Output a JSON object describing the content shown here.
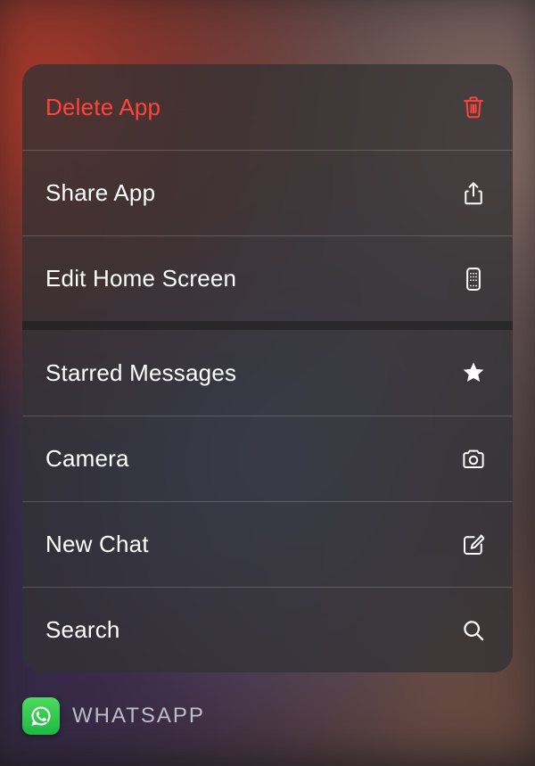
{
  "menu": {
    "groups": [
      {
        "items": [
          {
            "id": "delete-app",
            "label": "Delete App",
            "icon": "trash-icon",
            "destructive": true
          },
          {
            "id": "share-app",
            "label": "Share App",
            "icon": "share-icon",
            "destructive": false
          },
          {
            "id": "edit-home-screen",
            "label": "Edit Home Screen",
            "icon": "apps-grid-icon",
            "destructive": false
          }
        ]
      },
      {
        "items": [
          {
            "id": "starred-messages",
            "label": "Starred Messages",
            "icon": "star-icon",
            "destructive": false
          },
          {
            "id": "camera",
            "label": "Camera",
            "icon": "camera-icon",
            "destructive": false
          },
          {
            "id": "new-chat",
            "label": "New Chat",
            "icon": "compose-icon",
            "destructive": false
          },
          {
            "id": "search",
            "label": "Search",
            "icon": "search-icon",
            "destructive": false
          }
        ]
      }
    ]
  },
  "app": {
    "name": "WHATSAPP",
    "icon": "whatsapp-icon",
    "accent": "#25D366"
  },
  "colors": {
    "destructive": "#ff453a",
    "text": "#ffffff",
    "secondary_text": "rgba(235,235,245,0.75)"
  }
}
